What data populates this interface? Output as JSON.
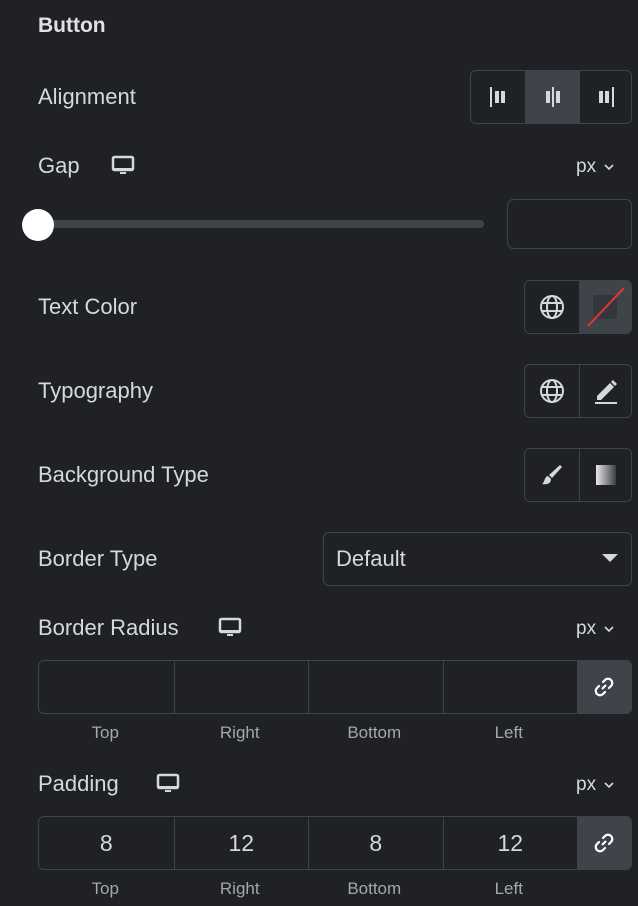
{
  "section": {
    "title": "Button"
  },
  "alignment": {
    "label": "Alignment",
    "options": [
      {
        "name": "start",
        "icon": "align-start-icon",
        "active": false
      },
      {
        "name": "center",
        "icon": "align-center-icon",
        "active": true
      },
      {
        "name": "end",
        "icon": "align-end-icon",
        "active": false
      }
    ]
  },
  "gap": {
    "label": "Gap",
    "device_icon": "desktop-icon",
    "unit": "px",
    "slider_value_fraction": 0,
    "input_value": ""
  },
  "text_color": {
    "label": "Text Color",
    "global_icon": "globe-icon",
    "swatch_icon": "no-color-swatch-icon"
  },
  "typography": {
    "label": "Typography",
    "global_icon": "globe-icon",
    "edit_icon": "pencil-icon"
  },
  "background_type": {
    "label": "Background Type",
    "options": [
      "classic-brush-icon",
      "gradient-icon"
    ]
  },
  "border_type": {
    "label": "Border Type",
    "selected": "Default"
  },
  "border_radius": {
    "label": "Border Radius",
    "device_icon": "desktop-icon",
    "unit": "px",
    "values": {
      "top": "",
      "right": "",
      "bottom": "",
      "left": ""
    },
    "labels": [
      "Top",
      "Right",
      "Bottom",
      "Left"
    ],
    "linked": true
  },
  "padding": {
    "label": "Padding",
    "device_icon": "desktop-icon",
    "unit": "px",
    "values": {
      "top": "8",
      "right": "12",
      "bottom": "8",
      "left": "12"
    },
    "labels": [
      "Top",
      "Right",
      "Bottom",
      "Left"
    ],
    "linked": true
  },
  "colors": {
    "background": "#1f2124",
    "border": "#3f444b",
    "active": "#3f444b",
    "text": "#d5d8dc",
    "no_color_slash": "#d9373a"
  }
}
